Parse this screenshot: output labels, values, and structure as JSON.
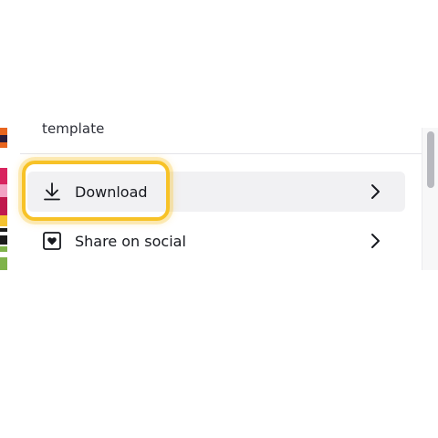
{
  "menu": {
    "previous_item_text": "template",
    "items": [
      {
        "label": "Download",
        "icon": "download-icon",
        "highlighted": true
      },
      {
        "label": "Share on social",
        "icon": "heart-icon",
        "highlighted": false
      }
    ]
  },
  "colors": {
    "highlight_ring": "#f7c227",
    "item_hover_bg": "#f1f1f3",
    "text": "#17191f"
  }
}
